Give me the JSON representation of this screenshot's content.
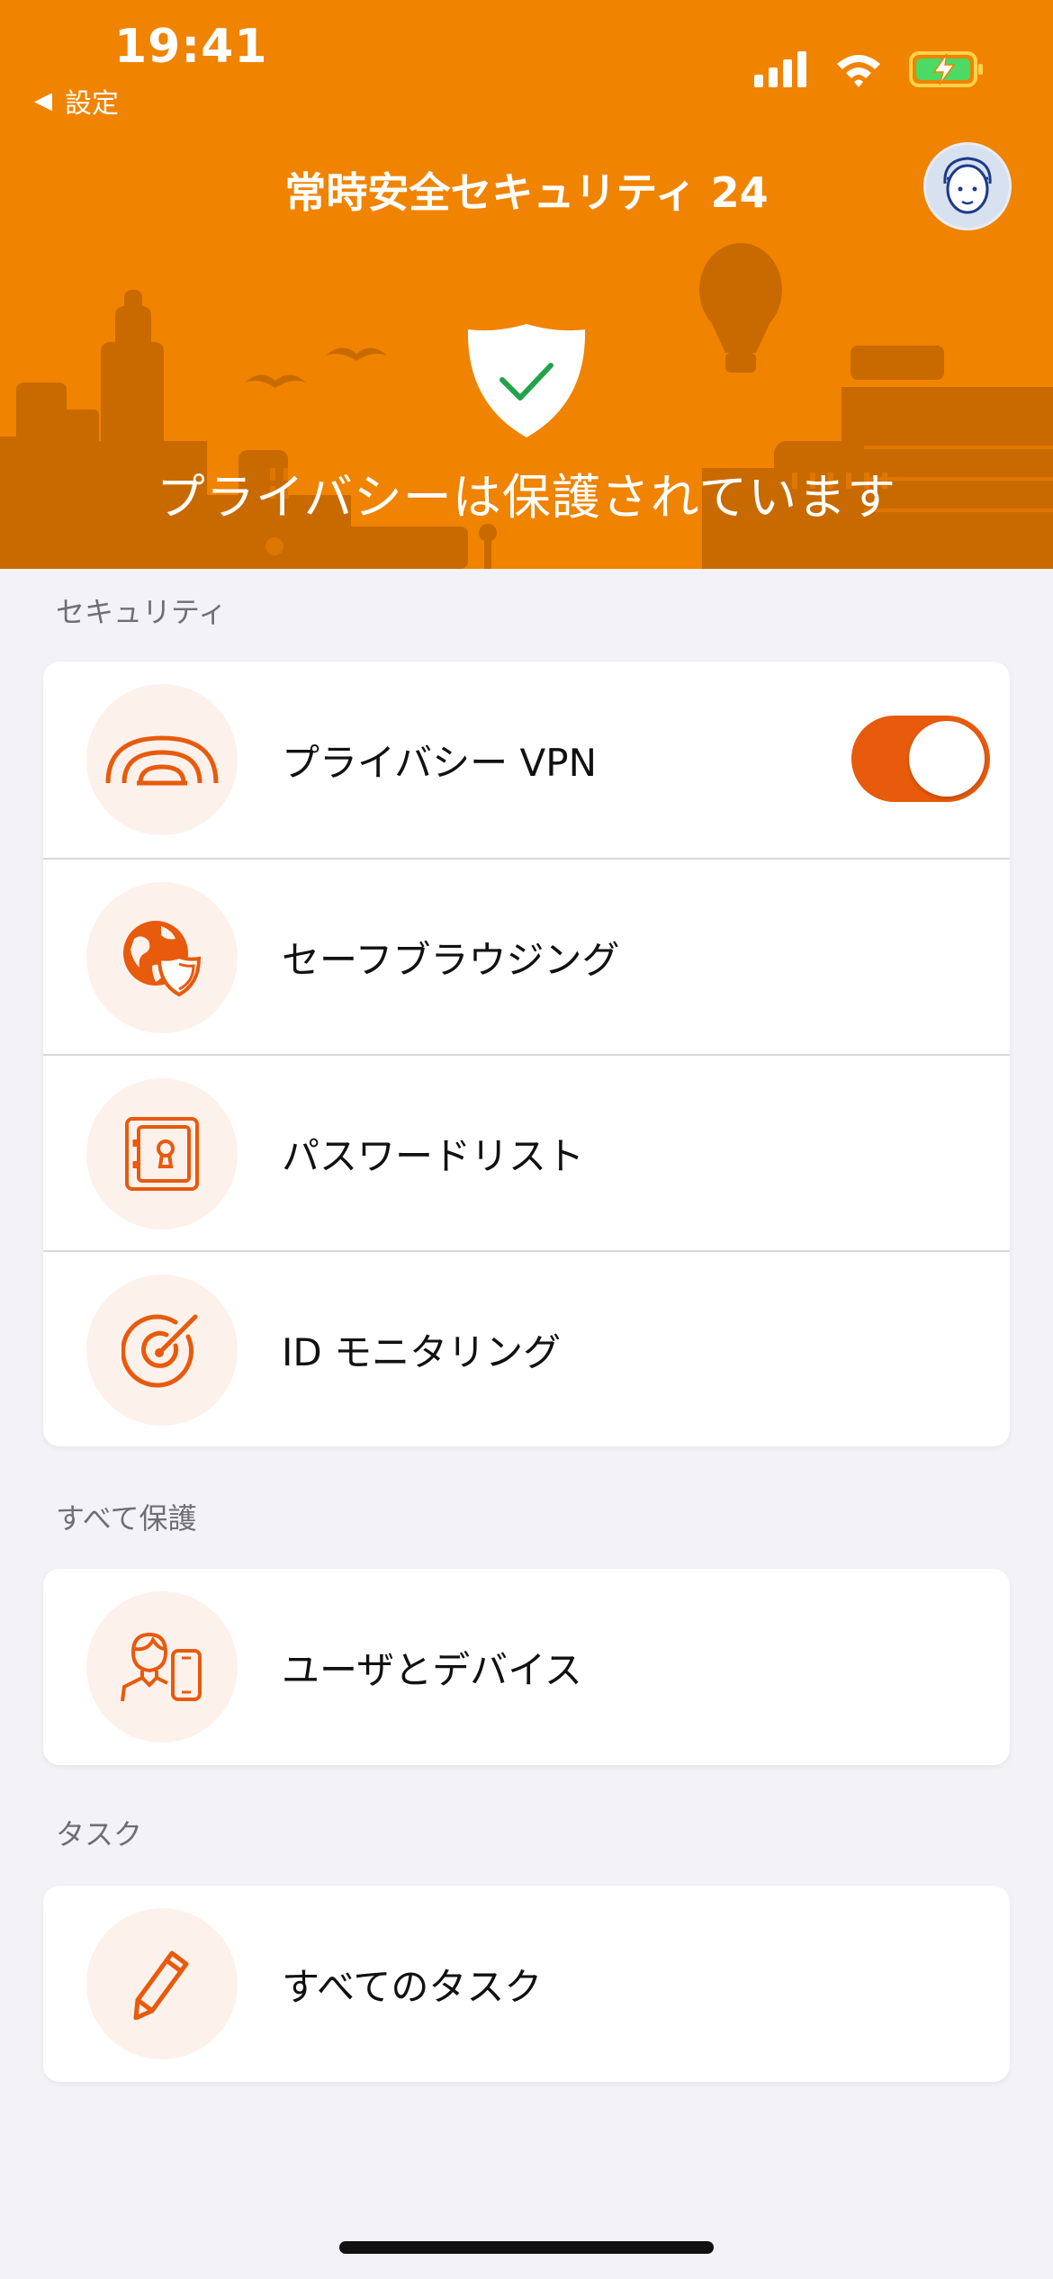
{
  "status_bar": {
    "time": "19:41",
    "back_label": "設定",
    "icons": [
      "back-arrow-icon",
      "cellular-signal-icon",
      "wifi-icon",
      "battery-charging-icon"
    ]
  },
  "header": {
    "title": "常時安全セキュリティ 24",
    "status_text": "プライバシーは保護されています",
    "colors": {
      "background": "#f08300",
      "skyline": "#c86a00"
    }
  },
  "sections": {
    "security": {
      "label": "セキュリティ",
      "items": [
        {
          "label": "プライバシー VPN",
          "icon": "vpn-signal-icon",
          "toggle_on": true
        },
        {
          "label": "セーフブラウジング",
          "icon": "globe-shield-icon"
        },
        {
          "label": "パスワードリスト",
          "icon": "vault-icon"
        },
        {
          "label": "ID モニタリング",
          "icon": "radar-icon"
        }
      ]
    },
    "protect_all": {
      "label": "すべて保護",
      "items": [
        {
          "label": "ユーザとデバイス",
          "icon": "user-device-icon"
        }
      ]
    },
    "tasks": {
      "label": "タスク",
      "items": [
        {
          "label": "すべてのタスク",
          "icon": "pencil-icon"
        }
      ]
    }
  },
  "colors": {
    "accent": "#e85a0c",
    "icon_bg": "#fdf1ec",
    "page_bg": "#f2f2f7"
  }
}
